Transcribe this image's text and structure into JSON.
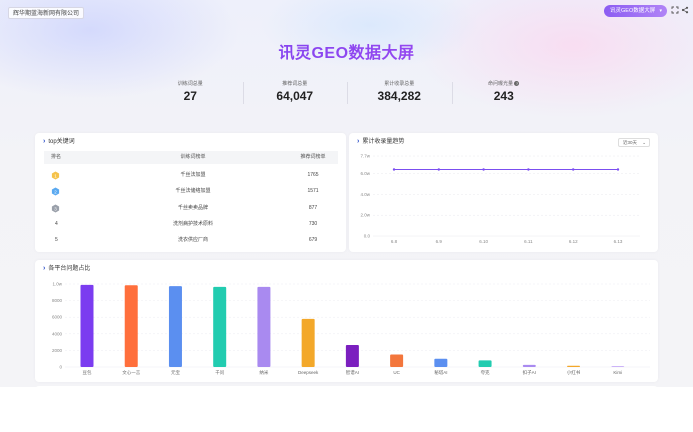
{
  "header": {
    "company": "辉华期蓝海新网有限公司",
    "title": "讯灵GEO数据大屏",
    "switch_label": "讯灵GEO数据大屏",
    "switch_chevron": "▾",
    "icons": [
      "fullscreen-icon",
      "share-icon"
    ]
  },
  "stats": [
    {
      "label": "训练词总量",
      "value": "27"
    },
    {
      "label": "推荐词总量",
      "value": "64,047"
    },
    {
      "label": "累计收录总量",
      "value": "384,282"
    },
    {
      "label": "命问曝光量",
      "value": "243",
      "info": "?"
    }
  ],
  "keywords": {
    "title": "top关键词",
    "columns": [
      "排名",
      "训练词榜单",
      "推荐词榜单"
    ],
    "rows": [
      {
        "rank": "1",
        "word": "千丝法加盟",
        "count": "1765"
      },
      {
        "rank": "2",
        "word": "千丝法储络加盟",
        "count": "1571"
      },
      {
        "rank": "3",
        "word": "千丝卖卖品牌",
        "count": "877"
      },
      {
        "rank": "4",
        "word": "洗剂病护技术原料",
        "count": "730"
      },
      {
        "rank": "5",
        "word": "洗衣供应厂商",
        "count": "679"
      }
    ]
  },
  "trend": {
    "title": "累计收录量趋势",
    "range": "近30天",
    "range_chevron": "⌄"
  },
  "platform": {
    "title": "各平台问题占比"
  },
  "chart_data": [
    {
      "type": "line",
      "title": "累计收录量趋势",
      "x": [
        "6.8",
        "6.9",
        "6.10",
        "6.11",
        "6.12",
        "6.13"
      ],
      "y_ticks": [
        "0.0",
        "2.0w",
        "4.0w",
        "6.0w",
        "7.7w"
      ],
      "ylim": [
        0,
        77000
      ],
      "series": [
        {
          "values": [
            64000,
            64000,
            64000,
            64000,
            64000,
            64000
          ],
          "color": "#7b4ef0"
        }
      ],
      "grid": true
    },
    {
      "type": "bar",
      "title": "各平台问题占比",
      "categories": [
        "豆包",
        "文心一言",
        "元宝",
        "千问",
        "纳米",
        "Deepseek",
        "智谱AI",
        "UC",
        "秘塔AI",
        "夸克",
        "扣子AI",
        "小红书",
        "Kimi"
      ],
      "values": [
        9900,
        9850,
        9750,
        9650,
        9650,
        5800,
        2650,
        1500,
        1000,
        800,
        250,
        150,
        40
      ],
      "colors": [
        "#7b3cf0",
        "#ff6f3c",
        "#5b8ff0",
        "#22ccb0",
        "#a98af0",
        "#f3a82a",
        "#7b1fbf",
        "#f3763c",
        "#5b8ff0",
        "#22ccb0",
        "#a98af0",
        "#f3a82a",
        "#7b3cf0"
      ],
      "y_ticks": [
        "0",
        "2000",
        "4000",
        "6000",
        "8000",
        "1.0w"
      ],
      "ylim": [
        0,
        10000
      ],
      "grid": true
    }
  ]
}
